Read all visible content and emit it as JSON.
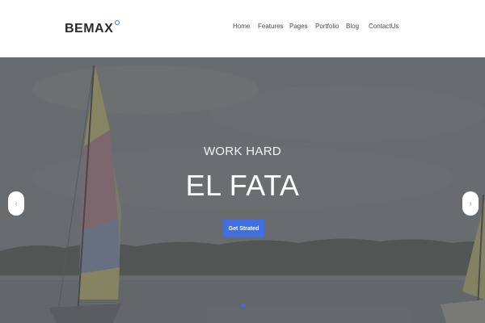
{
  "header": {
    "logo_text": "BEMAX",
    "nav": [
      {
        "label": "Home"
      },
      {
        "label": "Features"
      },
      {
        "label": "Pages"
      },
      {
        "label": "Portfolio"
      },
      {
        "label": "Blog"
      },
      {
        "label": "ContactUs"
      }
    ]
  },
  "hero": {
    "subtitle": "WORK HARD",
    "title": "EL FATA",
    "button_label": "Get Strated",
    "prev_arrow": "‹",
    "next_arrow": "›",
    "slide_count": 1,
    "active_slide": 1
  },
  "colors": {
    "accent": "#3f6fe0",
    "logo_ring": "#3b7bd8",
    "overlay": "#5a5c5e"
  },
  "icons": {
    "prev": "chevron-left-icon",
    "next": "chevron-right-icon"
  }
}
